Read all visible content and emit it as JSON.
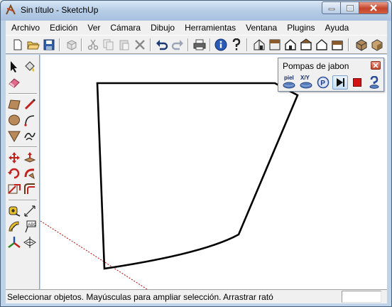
{
  "window": {
    "title": "Sin título - SketchUp"
  },
  "menu": {
    "items": [
      "Archivo",
      "Edición",
      "Ver",
      "Cámara",
      "Dibujo",
      "Herramientas",
      "Ventana",
      "Plugins",
      "Ayuda"
    ]
  },
  "floating_toolbar": {
    "title": "Pompas de jabon",
    "buttons": [
      {
        "name": "skin-button",
        "label": "piel",
        "icon": "soap-skin-icon"
      },
      {
        "name": "xy-button",
        "label": "X/Y",
        "icon": "soap-xy-icon"
      },
      {
        "name": "p-button",
        "label": "P",
        "icon": "p-circle-icon"
      },
      {
        "name": "play-button",
        "label": "",
        "icon": "play-icon"
      },
      {
        "name": "stop-button",
        "label": "",
        "icon": "stop-icon"
      },
      {
        "name": "help-button",
        "label": "",
        "icon": "question-icon"
      }
    ]
  },
  "status": {
    "text": "Seleccionar objetos. Mayúsculas para ampliar selección. Arrastrar rató",
    "value": ""
  },
  "colors": {
    "title_bar": "#b7cde6",
    "panel": "#f0f0f0",
    "canvas": "#ffffff",
    "edge": "#000000",
    "axis_red": "#c00000"
  }
}
